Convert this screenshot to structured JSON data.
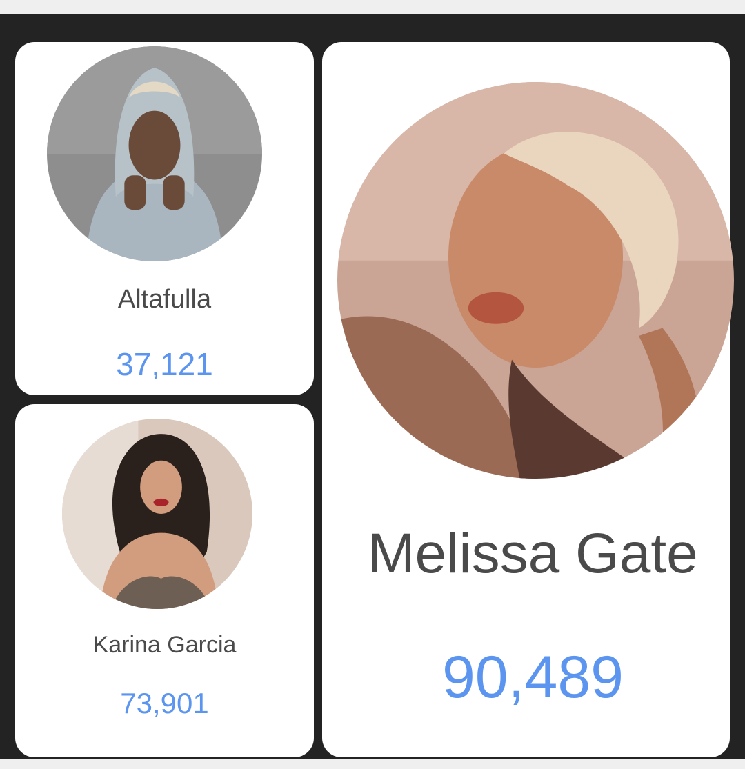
{
  "cards": [
    {
      "name": "Altafulla",
      "count": "37,121",
      "avatar_icon": "profile-photo-icon"
    },
    {
      "name": "Karina Garcia",
      "count": "73,901",
      "avatar_icon": "profile-photo-icon"
    },
    {
      "name": "Melissa Gate",
      "count": "90,489",
      "avatar_icon": "profile-photo-icon"
    }
  ],
  "colors": {
    "background": "#232323",
    "card": "#ffffff",
    "name_text": "#4a4a4a",
    "count_text": "#5b95f0"
  }
}
